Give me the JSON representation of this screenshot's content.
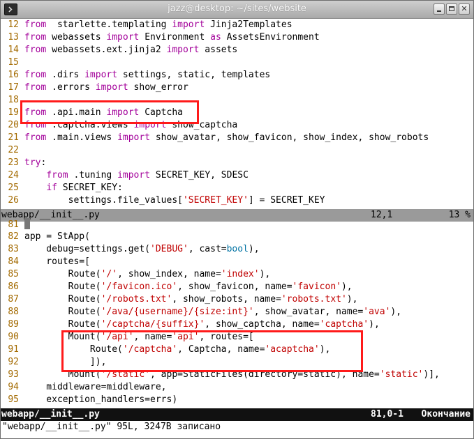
{
  "window": {
    "title": "jazz@desktop: ~/sites/website",
    "minimize_glyph": "",
    "maximize_glyph": "",
    "close_glyph": "✕"
  },
  "top_pane": {
    "lines": [
      {
        "n": "12",
        "segs": [
          [
            "kw",
            "from"
          ],
          [
            "",
            "  starlette.templating "
          ],
          [
            "kw",
            "import"
          ],
          [
            "",
            " Jinja2Templates"
          ]
        ]
      },
      {
        "n": "13",
        "segs": [
          [
            "kw",
            "from"
          ],
          [
            "",
            " webassets "
          ],
          [
            "kw",
            "import"
          ],
          [
            "",
            " Environment "
          ],
          [
            "kw",
            "as"
          ],
          [
            "",
            " AssetsEnvironment"
          ]
        ]
      },
      {
        "n": "14",
        "segs": [
          [
            "kw",
            "from"
          ],
          [
            "",
            " webassets.ext.jinja2 "
          ],
          [
            "kw",
            "import"
          ],
          [
            "",
            " assets"
          ]
        ]
      },
      {
        "n": "15",
        "segs": []
      },
      {
        "n": "16",
        "segs": [
          [
            "kw",
            "from"
          ],
          [
            "",
            " .dirs "
          ],
          [
            "kw",
            "import"
          ],
          [
            "",
            " settings, static, templates"
          ]
        ]
      },
      {
        "n": "17",
        "segs": [
          [
            "kw",
            "from"
          ],
          [
            "",
            " .errors "
          ],
          [
            "kw",
            "import"
          ],
          [
            "",
            " show_error"
          ]
        ]
      },
      {
        "n": "18",
        "segs": []
      },
      {
        "n": "19",
        "segs": [
          [
            "kw",
            "from"
          ],
          [
            "",
            " .api.main "
          ],
          [
            "kw",
            "import"
          ],
          [
            "",
            " Captcha"
          ]
        ]
      },
      {
        "n": "20",
        "segs": [
          [
            "kw",
            "from"
          ],
          [
            "",
            " .captcha.views "
          ],
          [
            "kw",
            "import"
          ],
          [
            "",
            " show_captcha"
          ]
        ]
      },
      {
        "n": "21",
        "segs": [
          [
            "kw",
            "from"
          ],
          [
            "",
            " .main.views "
          ],
          [
            "kw",
            "import"
          ],
          [
            "",
            " show_avatar, show_favicon, show_index, show_robots"
          ]
        ]
      },
      {
        "n": "22",
        "segs": []
      },
      {
        "n": "23",
        "segs": [
          [
            "kw",
            "try"
          ],
          [
            "",
            ":"
          ]
        ]
      },
      {
        "n": "24",
        "segs": [
          [
            "",
            "    "
          ],
          [
            "kw",
            "from"
          ],
          [
            "",
            " .tuning "
          ],
          [
            "kw",
            "import"
          ],
          [
            "",
            " SECRET_KEY, SDESC"
          ]
        ]
      },
      {
        "n": "25",
        "segs": [
          [
            "",
            "    "
          ],
          [
            "kw",
            "if"
          ],
          [
            "",
            " SECRET_KEY:"
          ]
        ]
      },
      {
        "n": "26",
        "segs": [
          [
            "",
            "        settings.file_values["
          ],
          [
            "st",
            "'SECRET_KEY'"
          ],
          [
            "",
            "] = SECRET_KEY"
          ]
        ]
      }
    ]
  },
  "top_status": {
    "filename": "webapp/__init__.py",
    "position": "12,1",
    "percent": "13 %"
  },
  "bottom_pane": {
    "lines": [
      {
        "n": "81",
        "segs": [],
        "cursor": true
      },
      {
        "n": "82",
        "segs": [
          [
            "",
            "app = StApp("
          ]
        ]
      },
      {
        "n": "83",
        "segs": [
          [
            "",
            "    debug=settings.get("
          ],
          [
            "st",
            "'DEBUG'"
          ],
          [
            "",
            ", cast="
          ],
          [
            "bi",
            "bool"
          ],
          [
            "",
            "),"
          ]
        ]
      },
      {
        "n": "84",
        "segs": [
          [
            "",
            "    routes=["
          ]
        ]
      },
      {
        "n": "85",
        "segs": [
          [
            "",
            "        Route("
          ],
          [
            "st",
            "'/'"
          ],
          [
            "",
            ", show_index, name="
          ],
          [
            "st",
            "'index'"
          ],
          [
            "",
            "),"
          ]
        ]
      },
      {
        "n": "86",
        "segs": [
          [
            "",
            "        Route("
          ],
          [
            "st",
            "'/favicon.ico'"
          ],
          [
            "",
            ", show_favicon, name="
          ],
          [
            "st",
            "'favicon'"
          ],
          [
            "",
            "),"
          ]
        ]
      },
      {
        "n": "87",
        "segs": [
          [
            "",
            "        Route("
          ],
          [
            "st",
            "'/robots.txt'"
          ],
          [
            "",
            ", show_robots, name="
          ],
          [
            "st",
            "'robots.txt'"
          ],
          [
            "",
            "),"
          ]
        ]
      },
      {
        "n": "88",
        "segs": [
          [
            "",
            "        Route("
          ],
          [
            "st",
            "'/ava/{username}/{size:int}'"
          ],
          [
            "",
            ", show_avatar, name="
          ],
          [
            "st",
            "'ava'"
          ],
          [
            "",
            "),"
          ]
        ]
      },
      {
        "n": "89",
        "segs": [
          [
            "",
            "        Route("
          ],
          [
            "st",
            "'/captcha/{suffix}'"
          ],
          [
            "",
            ", show_captcha, name="
          ],
          [
            "st",
            "'captcha'"
          ],
          [
            "",
            "),"
          ]
        ]
      },
      {
        "n": "90",
        "segs": [
          [
            "",
            "        Mount("
          ],
          [
            "st",
            "'/api'"
          ],
          [
            "",
            ", name="
          ],
          [
            "st",
            "'api'"
          ],
          [
            "",
            ", routes=["
          ]
        ]
      },
      {
        "n": "91",
        "segs": [
          [
            "",
            "            Route("
          ],
          [
            "st",
            "'/captcha'"
          ],
          [
            "",
            ", Captcha, name="
          ],
          [
            "st",
            "'acaptcha'"
          ],
          [
            "",
            "),"
          ]
        ]
      },
      {
        "n": "92",
        "segs": [
          [
            "",
            "            ]),"
          ]
        ]
      },
      {
        "n": "93",
        "segs": [
          [
            "",
            "        Mount("
          ],
          [
            "st",
            "'/static'"
          ],
          [
            "",
            ", app=StaticFiles(directory=static), name="
          ],
          [
            "st",
            "'static'"
          ],
          [
            "",
            ")],"
          ]
        ]
      },
      {
        "n": "94",
        "segs": [
          [
            "",
            "    middleware=middleware,"
          ]
        ]
      },
      {
        "n": "95",
        "segs": [
          [
            "",
            "    exception_handlers=errs)"
          ]
        ]
      }
    ]
  },
  "bottom_status": {
    "filename": "webapp/__init__.py",
    "position": "81,0-1",
    "percent": "Окончание"
  },
  "command_line": {
    "message": "\"webapp/__init__.py\" 95L, 3247B записано"
  },
  "colors": {
    "keyword": "#a3009a",
    "string": "#c00000",
    "builtin": "#0072a3",
    "line_number": "#a36a00",
    "highlight": "#ff1a1a"
  }
}
